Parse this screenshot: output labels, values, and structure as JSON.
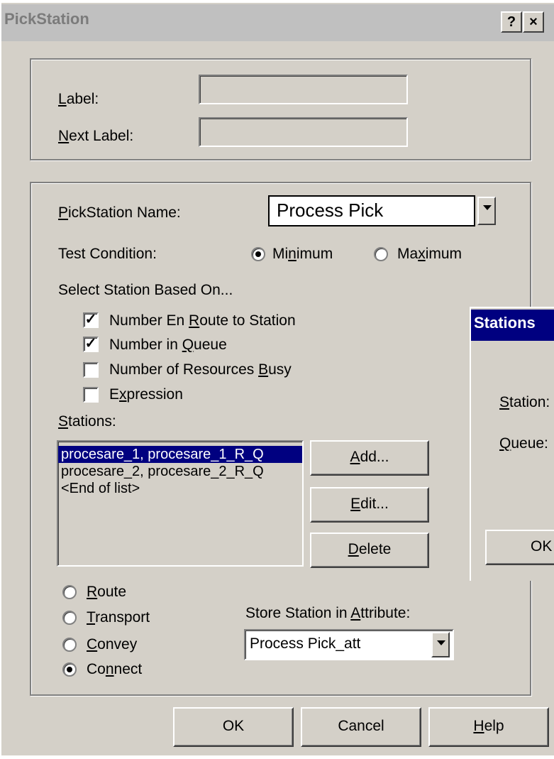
{
  "window": {
    "title": "PickStation",
    "help_button": "?",
    "close_button": "×"
  },
  "label_group": {
    "label": "Label:",
    "next_label": "Next Label:",
    "label_value": "",
    "next_label_value": ""
  },
  "main": {
    "pickstation_name_label": "PickStation Name:",
    "pickstation_name_value": "Process Pick",
    "test_condition_label": "Test Condition:",
    "test_condition_options": [
      {
        "label": "Minimum",
        "checked": true
      },
      {
        "label": "Maximum",
        "checked": false
      }
    ],
    "select_based_on_label": "Select Station Based On...",
    "criteria": [
      {
        "label": "Number En Route to Station",
        "checked": true
      },
      {
        "label": "Number in Queue",
        "checked": true
      },
      {
        "label": "Number of Resources Busy",
        "checked": false
      },
      {
        "label": "Expression",
        "checked": false
      }
    ],
    "stations_label": "Stations:",
    "stations_list": [
      {
        "text": "procesare_1, procesare_1_R_Q",
        "selected": true
      },
      {
        "text": "procesare_2, procesare_2_R_Q",
        "selected": false
      },
      {
        "text": "<End of list>",
        "selected": false
      }
    ],
    "add_button": "Add...",
    "edit_button": "Edit...",
    "delete_button": "Delete",
    "transfer_options": [
      {
        "label": "Route",
        "checked": false
      },
      {
        "label": "Transport",
        "checked": false
      },
      {
        "label": "Convey",
        "checked": false
      },
      {
        "label": "Connect",
        "checked": true
      }
    ],
    "store_attribute_label": "Store Station in Attribute:",
    "store_attribute_value": "Process Pick_att"
  },
  "footer": {
    "ok": "OK",
    "cancel": "Cancel",
    "help": "Help"
  },
  "side_dialog": {
    "title": "Stations",
    "station_label": "Station:",
    "queue_label": "Queue:",
    "ok_partial": "OK"
  },
  "colors": {
    "face": "#d4d0c8",
    "selection": "#000080",
    "side_title_bar": "#000080"
  }
}
